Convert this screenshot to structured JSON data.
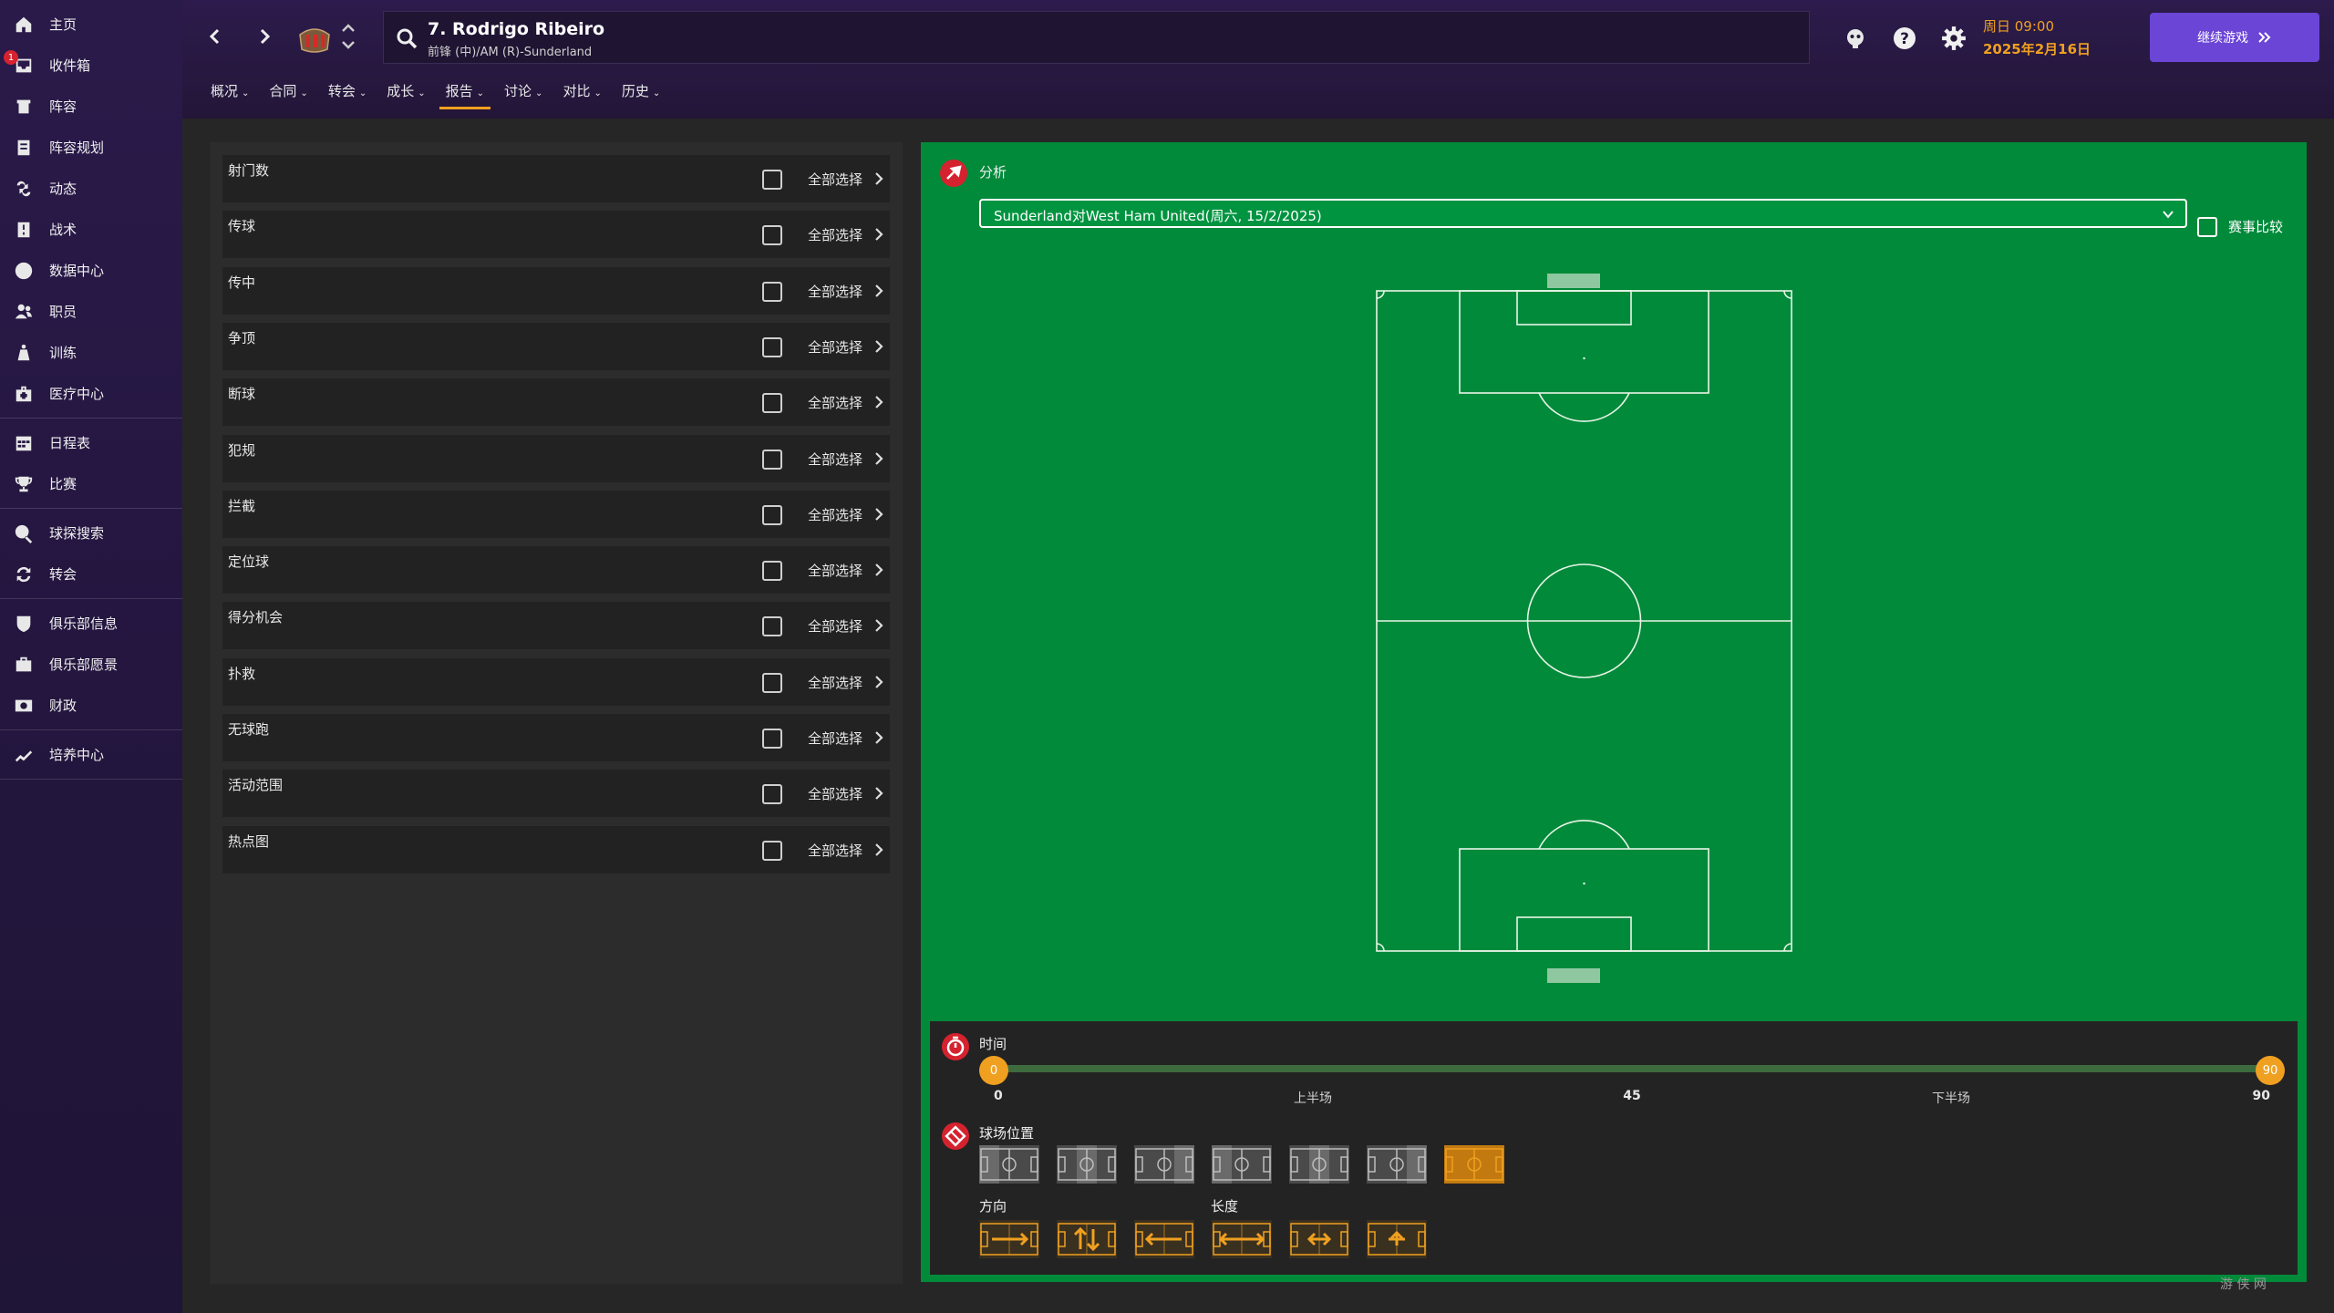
{
  "sidebar": {
    "groups": [
      [
        {
          "label": "主页",
          "icon": "home-icon"
        },
        {
          "label": "收件箱",
          "icon": "inbox-icon",
          "badge": "1"
        },
        {
          "label": "阵容",
          "icon": "squad-icon"
        },
        {
          "label": "阵容规划",
          "icon": "squad-planner-icon"
        },
        {
          "label": "动态",
          "icon": "dynamics-icon"
        },
        {
          "label": "战术",
          "icon": "tactics-icon"
        },
        {
          "label": "数据中心",
          "icon": "data-hub-icon"
        },
        {
          "label": "职员",
          "icon": "staff-icon"
        },
        {
          "label": "训练",
          "icon": "training-icon"
        },
        {
          "label": "医疗中心",
          "icon": "medical-icon"
        }
      ],
      [
        {
          "label": "日程表",
          "icon": "calendar-icon"
        },
        {
          "label": "比赛",
          "icon": "trophy-icon"
        }
      ],
      [
        {
          "label": "球探搜索",
          "icon": "scout-search-icon"
        },
        {
          "label": "转会",
          "icon": "transfer-icon"
        }
      ],
      [
        {
          "label": "俱乐部信息",
          "icon": "club-info-icon"
        },
        {
          "label": "俱乐部愿景",
          "icon": "club-vision-icon"
        },
        {
          "label": "财政",
          "icon": "finances-icon"
        }
      ],
      [
        {
          "label": "培养中心",
          "icon": "development-icon"
        }
      ]
    ]
  },
  "header": {
    "player_name": "7. Rodrigo Ribeiro",
    "player_sub": "前锋 (中)/AM (R)-Sunderland",
    "date_day": "周日 09:00",
    "date_full": "2025年2月16日",
    "continue_label": "继续游戏",
    "tabs": [
      {
        "label": "概况",
        "active": false
      },
      {
        "label": "合同",
        "active": false
      },
      {
        "label": "转会",
        "active": false
      },
      {
        "label": "成长",
        "active": false
      },
      {
        "label": "报告",
        "active": true
      },
      {
        "label": "讨论",
        "active": false
      },
      {
        "label": "对比",
        "active": false
      },
      {
        "label": "历史",
        "active": false
      }
    ]
  },
  "stats_list": {
    "select_all_label": "全部选择",
    "rows": [
      "射门数",
      "传球",
      "传中",
      "争顶",
      "断球",
      "犯规",
      "拦截",
      "定位球",
      "得分机会",
      "扑救",
      "无球跑",
      "活动范围",
      "热点图"
    ]
  },
  "analysis": {
    "title": "分析",
    "match": "Sunderland对West Ham United(周六, 15/2/2025)",
    "compare_label": "赛事比较"
  },
  "time_filter": {
    "title": "时间",
    "range": [
      0,
      90
    ],
    "ticks": [
      {
        "label": "0",
        "bold": true,
        "pos": 0
      },
      {
        "label": "上半场",
        "bold": false,
        "pos": 0.25
      },
      {
        "label": "45",
        "bold": true,
        "pos": 0.5
      },
      {
        "label": "下半场",
        "bold": false,
        "pos": 0.75
      },
      {
        "label": "90",
        "bold": true,
        "pos": 1
      }
    ],
    "position_label": "球场位置",
    "direction_label": "方向",
    "length_label": "长度"
  },
  "colors": {
    "accent": "#f0a020",
    "pitch": "#008a3a",
    "primary_button": "#6b45d6",
    "badge": "#d5222f"
  },
  "watermark": "游 侠 网"
}
